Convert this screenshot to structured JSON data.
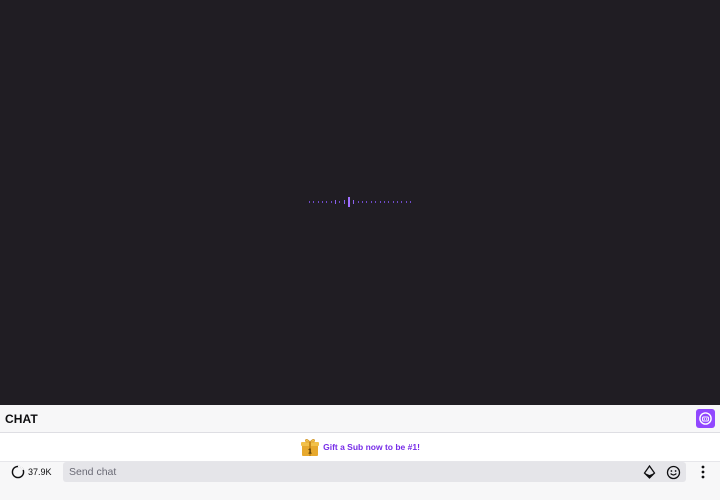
{
  "chat": {
    "title": "CHAT",
    "menu_icon": "community-points-icon"
  },
  "gift_banner": {
    "icon": "gift-icon",
    "text": "Gift a Sub now to be #1!"
  },
  "viewers": {
    "icon": "viewer-count-icon",
    "count": "37.9K"
  },
  "chat_input": {
    "placeholder": "Send chat",
    "icons": [
      "bits-icon",
      "emote-icon",
      "more-options-icon"
    ]
  },
  "colors": {
    "player_bg": "#201d23",
    "brand": "#9147ff",
    "banner_text": "#772ce8"
  }
}
